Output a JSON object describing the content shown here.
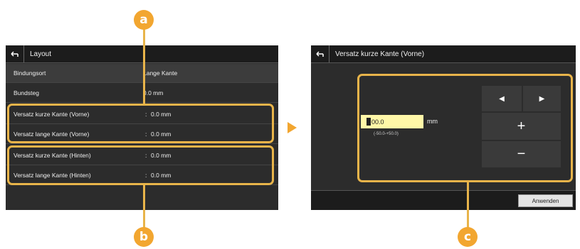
{
  "left_screen": {
    "title": "Layout",
    "rows": [
      {
        "label": "Bindungsort",
        "value": "Lange Kante"
      },
      {
        "label": "Bundsteg",
        "value": "0.0 mm"
      },
      {
        "label": "Versatz kurze Kante (Vorne)",
        "value": "0.0 mm"
      },
      {
        "label": "Versatz lange Kante (Vorne)",
        "value": "0.0 mm"
      },
      {
        "label": "Versatz kurze Kante (Hinten)",
        "value": "0.0 mm"
      },
      {
        "label": "Versatz lange Kante (Hinten)",
        "value": "0.0 mm"
      }
    ],
    "separator": ":"
  },
  "right_screen": {
    "title": "Versatz kurze Kante (Vorne)",
    "input_value": "00.0",
    "unit": "mm",
    "range": "(-50.0-+50.0)",
    "plus_label": "+",
    "minus_label": "−",
    "left_arrow": "◀",
    "right_arrow": "▶",
    "apply_label": "Anwenden"
  },
  "callouts": {
    "a": "a",
    "b": "b",
    "c": "c"
  },
  "colors": {
    "accent": "#f2a630",
    "screen_bg": "#2c2c2c",
    "input_bg": "#fff7a8"
  },
  "icons": {
    "back": "back-arrow-icon",
    "pointer": "triangle-arrow-icon"
  }
}
